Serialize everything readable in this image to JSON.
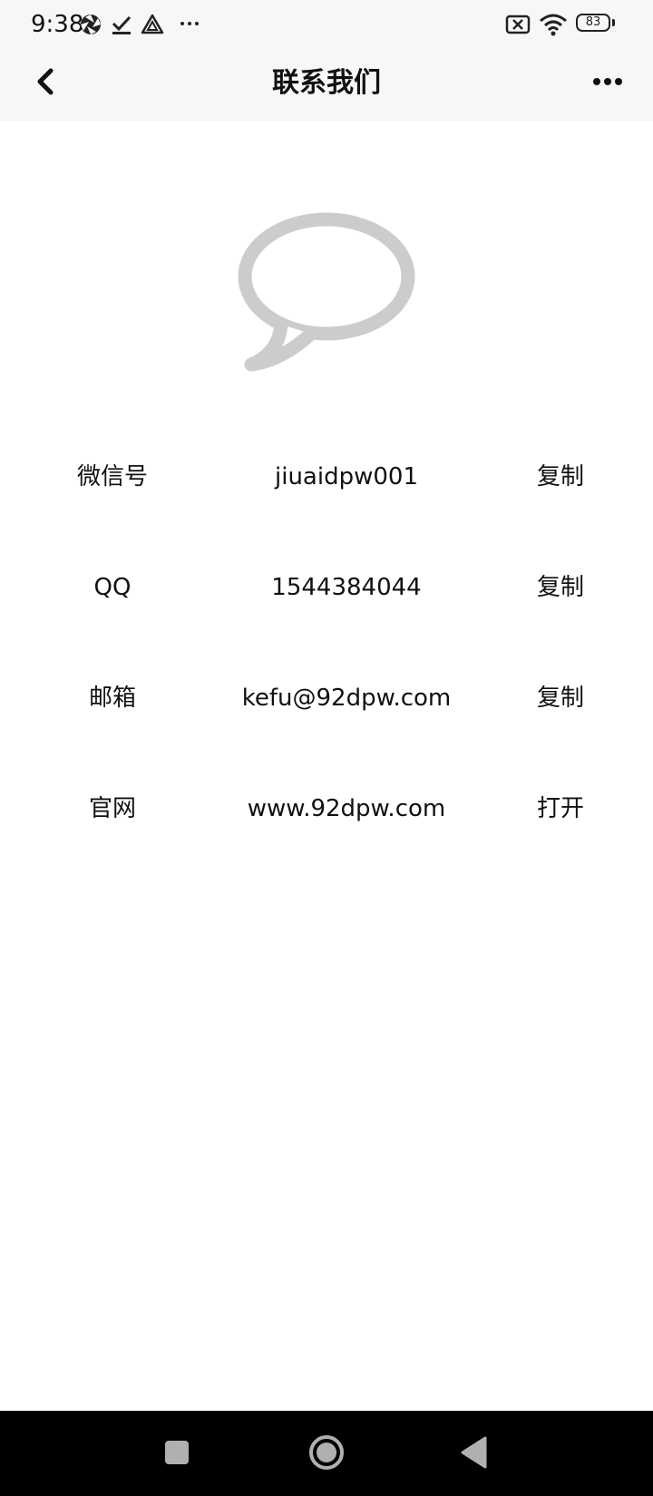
{
  "status_bar": {
    "time": "9:38",
    "battery": "83",
    "icons": [
      "aperture-icon",
      "check-download-icon",
      "triangle-alert-icon",
      "more-dots-icon",
      "sim-x-icon",
      "wifi-icon",
      "battery-icon"
    ]
  },
  "nav": {
    "title": "联系我们",
    "back_icon": "chevron-left-icon",
    "more_icon": "more-horizontal-icon"
  },
  "hero": {
    "icon": "speech-bubble-icon",
    "color": "#cccccc"
  },
  "contacts": [
    {
      "label": "微信号",
      "value": "jiuaidpw001",
      "action": "复制"
    },
    {
      "label": "QQ",
      "value": "1544384044",
      "action": "复制"
    },
    {
      "label": "邮箱",
      "value": "kefu@92dpw.com",
      "action": "复制"
    },
    {
      "label": "官网",
      "value": "www.92dpw.com",
      "action": "打开"
    }
  ],
  "system_nav": {
    "recents_icon": "square-icon",
    "home_icon": "circle-home-icon",
    "back_icon": "triangle-back-icon",
    "color": "#b0b0b0"
  }
}
